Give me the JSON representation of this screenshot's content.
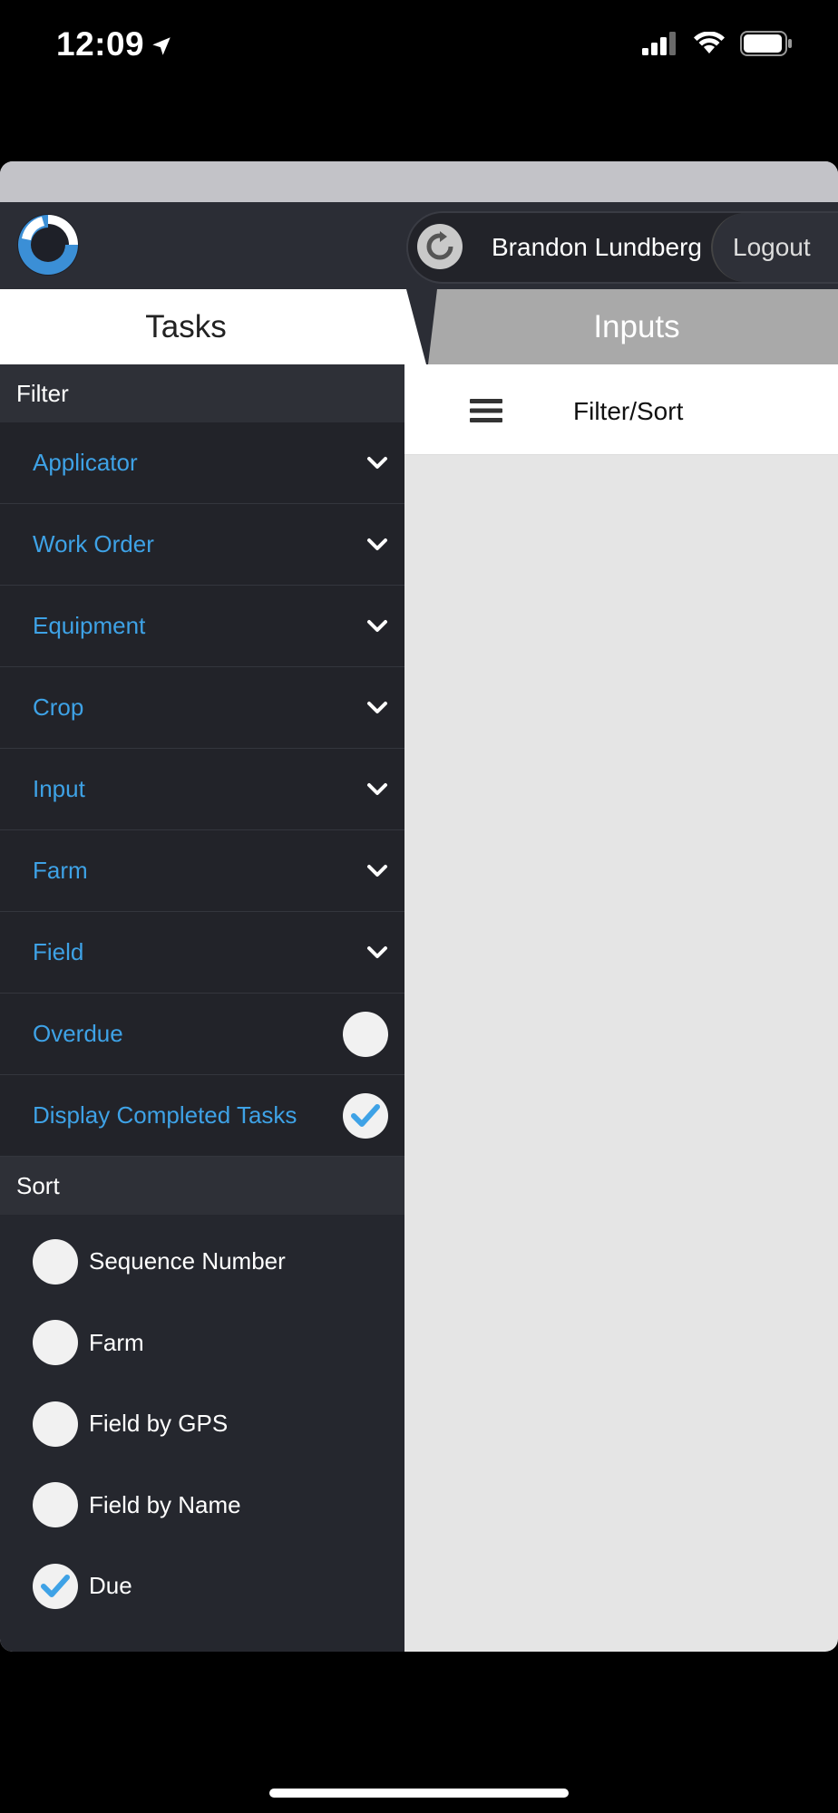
{
  "status": {
    "time": "12:09"
  },
  "header": {
    "user_name": "Brandon Lundberg",
    "logout_label": "Logout"
  },
  "tabs": [
    {
      "label": "Tasks",
      "active": true
    },
    {
      "label": "Inputs",
      "active": false
    }
  ],
  "filter": {
    "title": "Filter",
    "dropdowns": [
      "Applicator",
      "Work Order",
      "Equipment",
      "Crop",
      "Input",
      "Farm",
      "Field"
    ],
    "toggles": [
      {
        "label": "Overdue",
        "checked": false
      },
      {
        "label": "Display Completed Tasks",
        "checked": true
      }
    ]
  },
  "sort": {
    "title": "Sort",
    "options": [
      {
        "label": "Sequence Number",
        "selected": false
      },
      {
        "label": "Farm",
        "selected": false
      },
      {
        "label": "Field by GPS",
        "selected": false
      },
      {
        "label": "Field by Name",
        "selected": false
      },
      {
        "label": "Due",
        "selected": true
      }
    ]
  },
  "toolbar": {
    "filter_sort_label": "Filter/Sort"
  },
  "colors": {
    "accent": "#3ea2e6",
    "panel": "#25272e",
    "header": "#2b2d35"
  }
}
